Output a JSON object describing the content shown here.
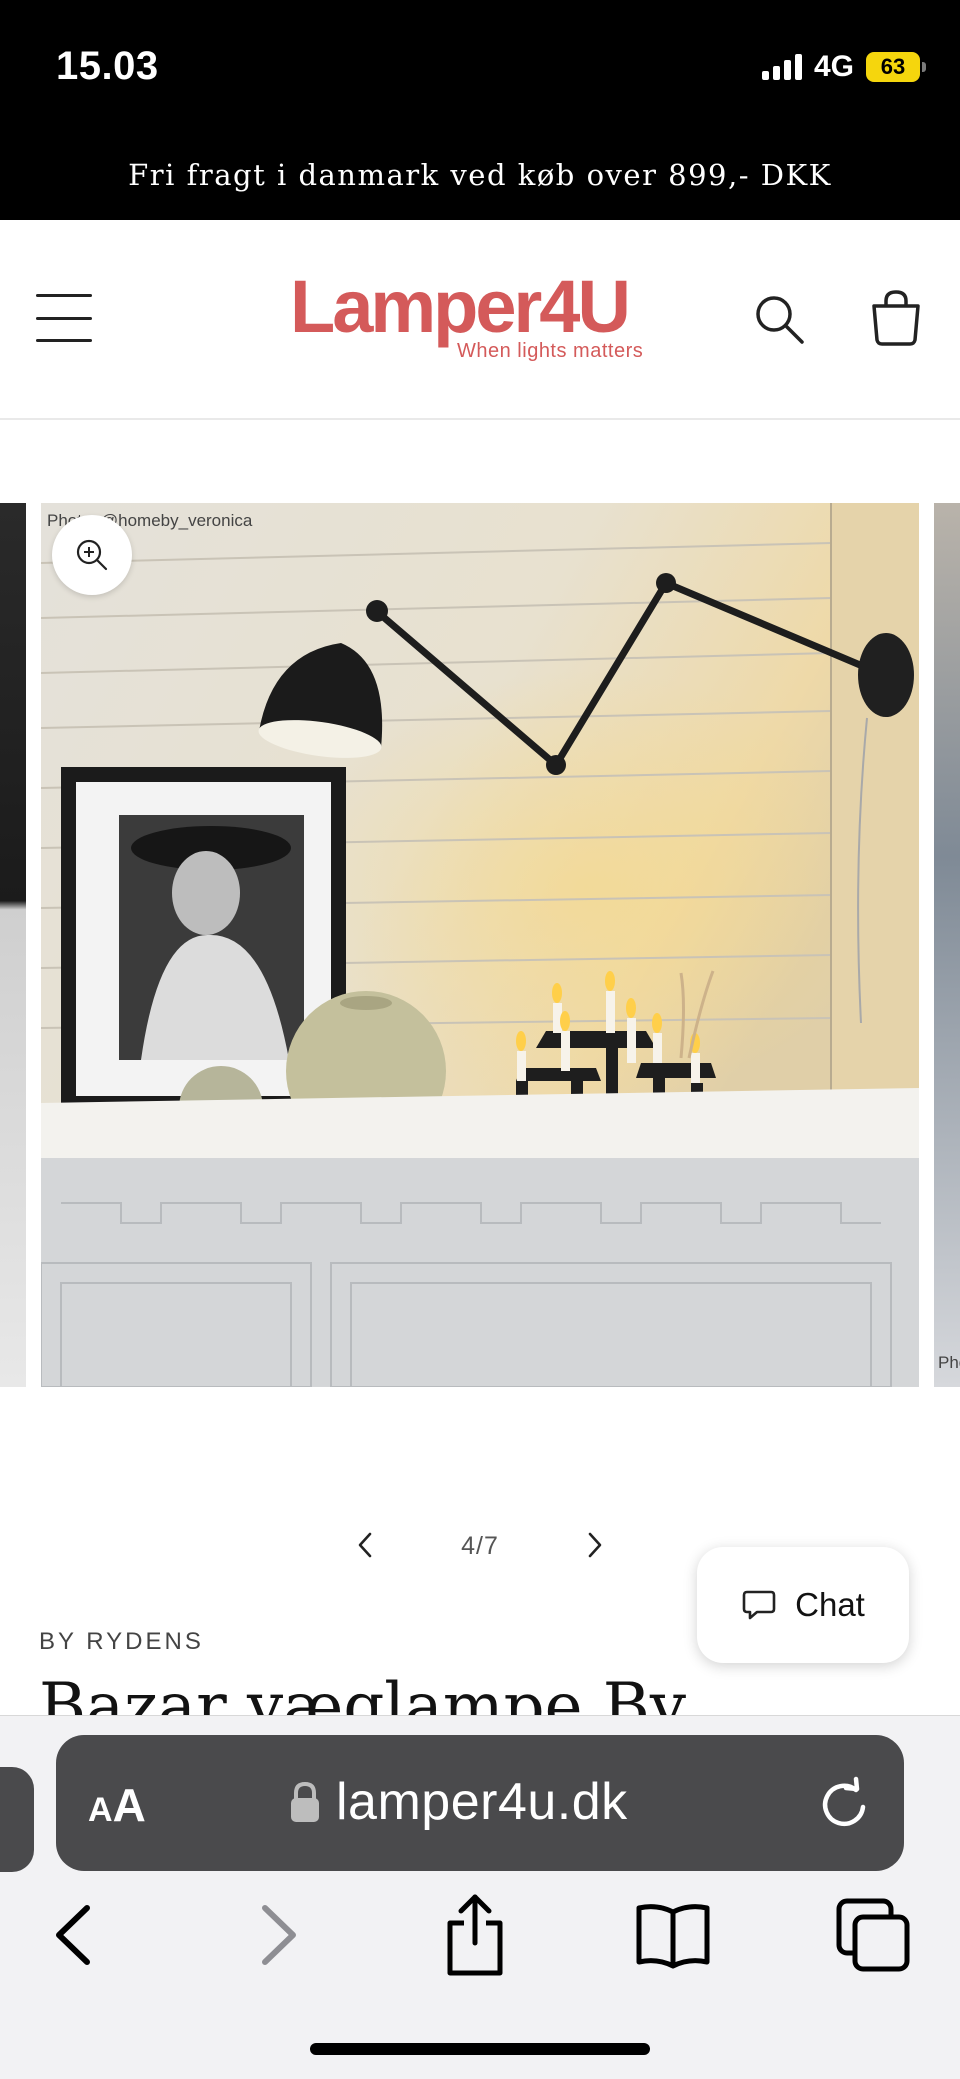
{
  "status_bar": {
    "time": "15.03",
    "network": "4G",
    "battery": "63"
  },
  "announcement": {
    "text": "Fri fragt i danmark ved køb over 899,- DKK"
  },
  "header": {
    "logo_text": "Lamper4U",
    "logo_tagline": "When lights matters",
    "brand_color": "#d45a5a"
  },
  "gallery": {
    "photo_credit": "Photo: @homeby_veronica",
    "next_photo_credit": "Pho",
    "counter": "4/7",
    "icons": [
      "zoom-in-icon",
      "chevron-left-icon",
      "chevron-right-icon"
    ]
  },
  "chat": {
    "label": "Chat",
    "icon": "chat-bubble-icon"
  },
  "product": {
    "vendor": "BY RYDENS",
    "title": "Bazar væglampe By"
  },
  "browser": {
    "aa_small": "A",
    "aa_big": "A",
    "url": "lamper4u.dk",
    "icons": [
      "lock-icon",
      "reload-icon",
      "back-icon",
      "forward-icon",
      "share-icon",
      "bookmarks-icon",
      "tabs-icon"
    ]
  }
}
